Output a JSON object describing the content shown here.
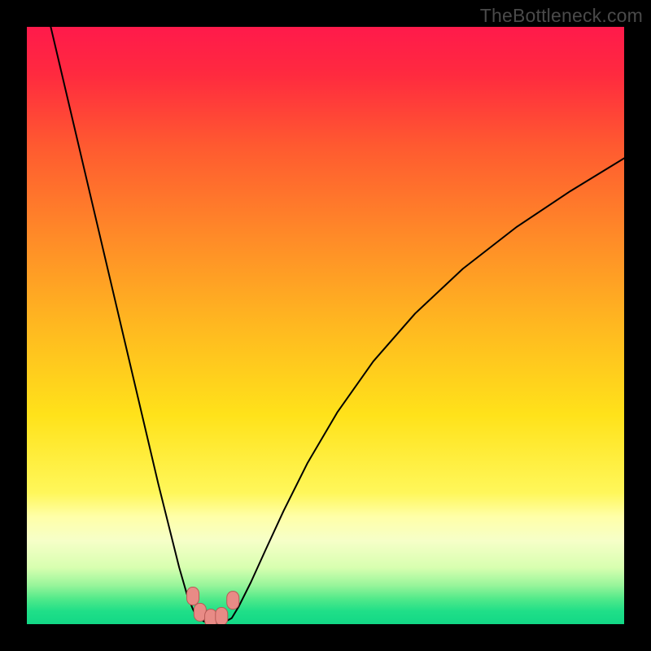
{
  "watermark": "TheBottleneck.com",
  "colors": {
    "gradient_stops": [
      {
        "offset": 0.0,
        "color": "#ff1a4b"
      },
      {
        "offset": 0.08,
        "color": "#ff2a3f"
      },
      {
        "offset": 0.2,
        "color": "#ff5a30"
      },
      {
        "offset": 0.35,
        "color": "#ff8a28"
      },
      {
        "offset": 0.5,
        "color": "#ffb820"
      },
      {
        "offset": 0.65,
        "color": "#ffe21a"
      },
      {
        "offset": 0.78,
        "color": "#fff75a"
      },
      {
        "offset": 0.82,
        "color": "#ffffa8"
      },
      {
        "offset": 0.86,
        "color": "#f6ffc8"
      },
      {
        "offset": 0.905,
        "color": "#d8ffb0"
      },
      {
        "offset": 0.935,
        "color": "#98f59a"
      },
      {
        "offset": 0.958,
        "color": "#50e98a"
      },
      {
        "offset": 0.978,
        "color": "#20df88"
      },
      {
        "offset": 1.0,
        "color": "#12d886"
      }
    ],
    "curve": "#000000",
    "marker_fill": "#e88b86",
    "marker_stroke": "#b85a56",
    "frame": "#000000"
  },
  "chart_data": {
    "type": "line",
    "title": "",
    "xlabel": "",
    "ylabel": "",
    "xlim": [
      0,
      1
    ],
    "ylim": [
      0,
      1
    ],
    "note": "No axis ticks or labels are rendered in the image; values are normalized 0–1 estimates read from pixel position. y=0 is the bottom (green), y=1 is the top (red).",
    "series": [
      {
        "name": "left-branch",
        "x": [
          0.04,
          0.06,
          0.08,
          0.1,
          0.12,
          0.14,
          0.16,
          0.18,
          0.2,
          0.22,
          0.24,
          0.255,
          0.268,
          0.278,
          0.286
        ],
        "y": [
          1.0,
          0.915,
          0.83,
          0.745,
          0.66,
          0.575,
          0.49,
          0.405,
          0.32,
          0.235,
          0.155,
          0.095,
          0.05,
          0.025,
          0.01
        ]
      },
      {
        "name": "valley-floor",
        "x": [
          0.286,
          0.3,
          0.315,
          0.33,
          0.343
        ],
        "y": [
          0.01,
          0.003,
          0.002,
          0.003,
          0.01
        ]
      },
      {
        "name": "right-branch",
        "x": [
          0.343,
          0.355,
          0.375,
          0.4,
          0.43,
          0.47,
          0.52,
          0.58,
          0.65,
          0.73,
          0.82,
          0.91,
          1.0
        ],
        "y": [
          0.01,
          0.03,
          0.07,
          0.125,
          0.19,
          0.27,
          0.355,
          0.44,
          0.52,
          0.595,
          0.665,
          0.725,
          0.78
        ]
      }
    ],
    "markers": [
      {
        "x": 0.278,
        "y": 0.047,
        "shape": "rounded"
      },
      {
        "x": 0.29,
        "y": 0.02,
        "shape": "rounded"
      },
      {
        "x": 0.308,
        "y": 0.01,
        "shape": "rounded"
      },
      {
        "x": 0.326,
        "y": 0.013,
        "shape": "rounded"
      },
      {
        "x": 0.345,
        "y": 0.04,
        "shape": "rounded"
      }
    ]
  }
}
